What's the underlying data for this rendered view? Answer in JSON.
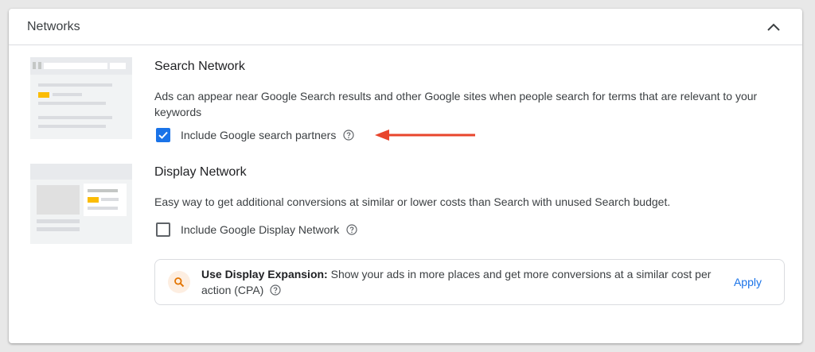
{
  "card": {
    "title": "Networks",
    "collapse_icon": "chevron-up-icon"
  },
  "search_network": {
    "title": "Search Network",
    "description": "Ads can appear near Google Search results and other Google sites when people search for terms that are relevant to your keywords",
    "checkbox_label": "Include Google search partners",
    "checked": true
  },
  "display_network": {
    "title": "Display Network",
    "description": "Easy way to get additional conversions at similar or lower costs than Search with unused Search budget.",
    "checkbox_label": "Include Google Display Network",
    "checked": false
  },
  "display_expansion": {
    "icon": "search-icon",
    "heading": "Use Display Expansion:",
    "body": " Show your ads in more places and get more conversions at a similar cost per action (CPA)",
    "apply_label": "Apply"
  },
  "colors": {
    "accent": "#1a73e8",
    "annotation_arrow": "#e8452c",
    "thumb_yellow": "#fbbc04"
  }
}
